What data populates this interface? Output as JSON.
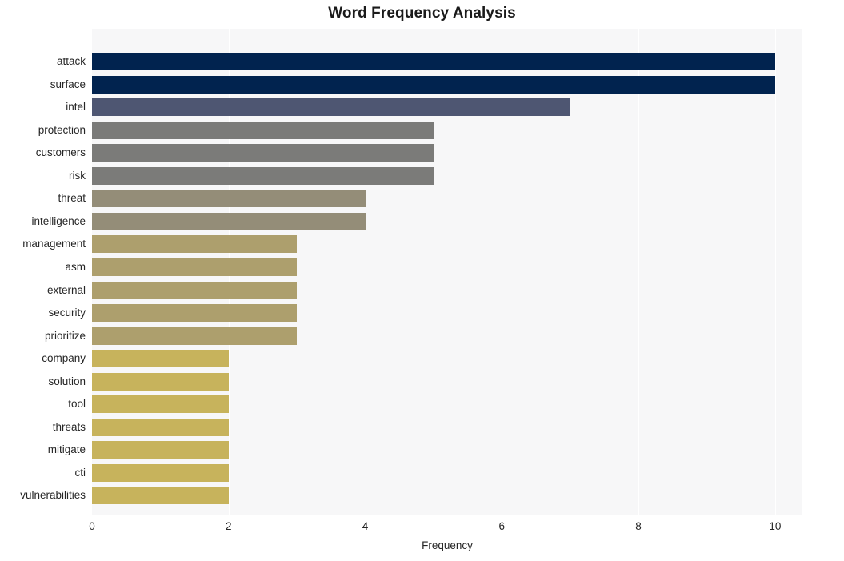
{
  "chart_data": {
    "type": "bar",
    "orientation": "horizontal",
    "title": "Word Frequency Analysis",
    "xlabel": "Frequency",
    "ylabel": "",
    "categories": [
      "attack",
      "surface",
      "intel",
      "protection",
      "customers",
      "risk",
      "threat",
      "intelligence",
      "management",
      "asm",
      "external",
      "security",
      "prioritize",
      "company",
      "solution",
      "tool",
      "threats",
      "mitigate",
      "cti",
      "vulnerabilities"
    ],
    "values": [
      10,
      10,
      7,
      5,
      5,
      5,
      4,
      4,
      3,
      3,
      3,
      3,
      3,
      2,
      2,
      2,
      2,
      2,
      2,
      2
    ],
    "bar_colors": [
      "#01234f",
      "#01234f",
      "#4e5672",
      "#7b7b79",
      "#7b7b79",
      "#7b7b79",
      "#948d78",
      "#948d78",
      "#ad9f6d",
      "#ad9f6d",
      "#ad9f6d",
      "#ad9f6d",
      "#ad9f6d",
      "#c7b35c",
      "#c7b35c",
      "#c7b35c",
      "#c7b35c",
      "#c7b35c",
      "#c7b35c",
      "#c7b35c"
    ],
    "xticks": [
      0,
      2,
      4,
      6,
      8,
      10
    ],
    "xtick_labels": [
      "0",
      "2",
      "4",
      "6",
      "8",
      "10"
    ],
    "xlim": [
      0,
      10.4
    ],
    "grid": true,
    "grid_axis": "x",
    "legend": null,
    "plot_background": "#f7f7f8",
    "figure_background": "#ffffff",
    "gridline_color": "#ffffff"
  }
}
